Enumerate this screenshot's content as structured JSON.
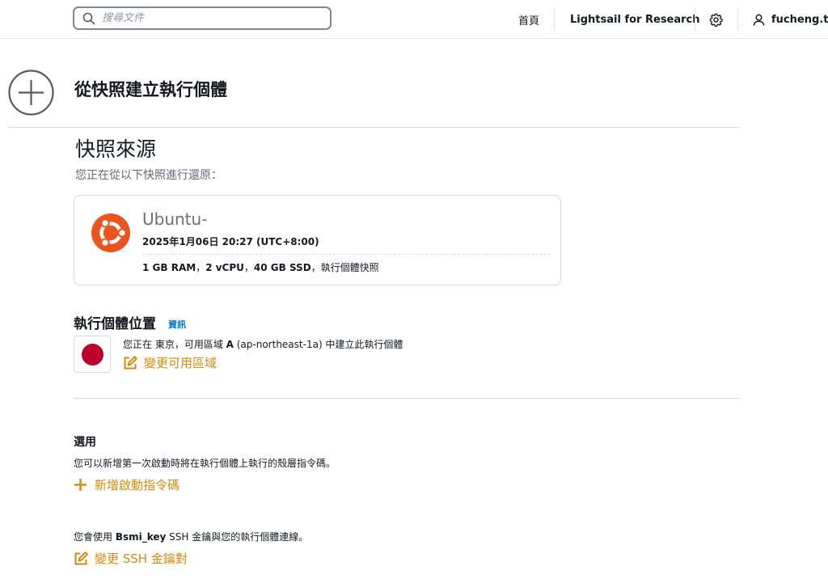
{
  "search": {
    "placeholder": "搜尋文件"
  },
  "nav": {
    "home": "首頁",
    "lightsail_research": "Lightsail for Research",
    "user": "fucheng.tsa"
  },
  "page": {
    "title": "從快照建立執行個體"
  },
  "snapshot_source": {
    "heading": "快照來源",
    "description": "您正在從以下快照進行還原：",
    "os_name": "Ubuntu-",
    "date": "2025年1月06日 20:27 (UTC+8:00)",
    "specs": {
      "ram": "1 GB RAM",
      "sep1": "，",
      "vcpu": "2 vCPU",
      "sep2": "，",
      "ssd": "40 GB SSD",
      "suffix": "，執行個體快照"
    }
  },
  "location": {
    "heading": "執行個體位置",
    "info_link": "資訊",
    "text_prefix": "您正在 東京，可用區域 ",
    "zone_letter": "A",
    "text_suffix": " (ap-northeast-1a) 中建立此執行個體",
    "change_az": "變更可用區域",
    "flag_color": "#bc002d"
  },
  "optional": {
    "heading": "選用",
    "description": "您可以新增第一次啟動時將在執行個體上執行的殼層指令碼。",
    "add_script": "新增啟動指令碼"
  },
  "ssh": {
    "text_prefix": "您會使用 ",
    "key_name": "Bsmi_key",
    "text_suffix": " SSH 金鑰與您的執行個體連線。",
    "change_key": "變更 SSH 金鑰對"
  },
  "colors": {
    "accent_orange": "#d48a0e",
    "link_blue": "#0073bb",
    "ubuntu_orange": "#e95420"
  }
}
